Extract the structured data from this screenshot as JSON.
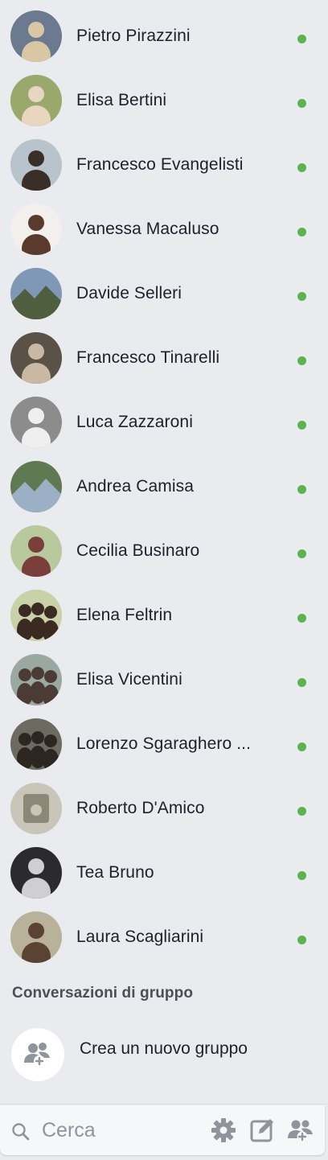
{
  "contacts": [
    {
      "name": "Pietro Pirazzini",
      "online": true,
      "avatar": {
        "bg": "#6b7a8f",
        "fg": "#d9c7a4",
        "icon": "person-photo"
      }
    },
    {
      "name": "Elisa Bertini",
      "online": true,
      "avatar": {
        "bg": "#9aa86b",
        "fg": "#e8d6c0",
        "icon": "person-photo"
      }
    },
    {
      "name": "Francesco Evangelisti",
      "online": true,
      "avatar": {
        "bg": "#b9c3cc",
        "fg": "#3a2e28",
        "icon": "person-photo"
      }
    },
    {
      "name": "Vanessa Macaluso",
      "online": true,
      "avatar": {
        "bg": "#f2efec",
        "fg": "#5a3a2c",
        "icon": "person-photo"
      }
    },
    {
      "name": "Davide Selleri",
      "online": true,
      "avatar": {
        "bg": "#7f98b5",
        "fg": "#4f5e3f",
        "icon": "landscape-photo"
      }
    },
    {
      "name": "Francesco Tinarelli",
      "online": true,
      "avatar": {
        "bg": "#5b5247",
        "fg": "#c9b8a3",
        "icon": "person-photo"
      }
    },
    {
      "name": "Luca Zazzaroni",
      "online": true,
      "avatar": {
        "bg": "#8c8c8c",
        "fg": "#efefef",
        "icon": "person-photo"
      }
    },
    {
      "name": "Andrea Camisa",
      "online": true,
      "avatar": {
        "bg": "#5f7a52",
        "fg": "#9bb0c4",
        "icon": "landscape-photo"
      }
    },
    {
      "name": "Cecilia Businaro",
      "online": true,
      "avatar": {
        "bg": "#b9c99e",
        "fg": "#7a3f3a",
        "icon": "person-photo"
      }
    },
    {
      "name": "Elena Feltrin",
      "online": true,
      "avatar": {
        "bg": "#c8d1a8",
        "fg": "#3b2a22",
        "icon": "group-photo"
      }
    },
    {
      "name": "Elisa Vicentini",
      "online": true,
      "avatar": {
        "bg": "#9ba8a1",
        "fg": "#4a3b35",
        "icon": "group-photo"
      }
    },
    {
      "name": "Lorenzo Sgaraghero ...",
      "online": true,
      "avatar": {
        "bg": "#6d6a62",
        "fg": "#2c2520",
        "icon": "group-photo"
      }
    },
    {
      "name": "Roberto D'Amico",
      "online": true,
      "avatar": {
        "bg": "#c9c5b9",
        "fg": "#8d8778",
        "icon": "object-photo"
      }
    },
    {
      "name": "Tea Bruno",
      "online": true,
      "avatar": {
        "bg": "#2b2b2e",
        "fg": "#cfcfd2",
        "icon": "person-photo"
      }
    },
    {
      "name": "Laura Scagliarini",
      "online": true,
      "avatar": {
        "bg": "#b7b299",
        "fg": "#5a4332",
        "icon": "person-photo"
      }
    }
  ],
  "group_section": {
    "title": "Conversazioni di gruppo",
    "create_label": "Crea un nuovo gruppo"
  },
  "bottom_bar": {
    "search_placeholder": "Cerca",
    "icons": [
      "gear-icon",
      "compose-icon",
      "new-group-icon"
    ]
  },
  "colors": {
    "online": "#5fb34e",
    "background": "#e9ebee",
    "icon_gray": "#90949c"
  }
}
